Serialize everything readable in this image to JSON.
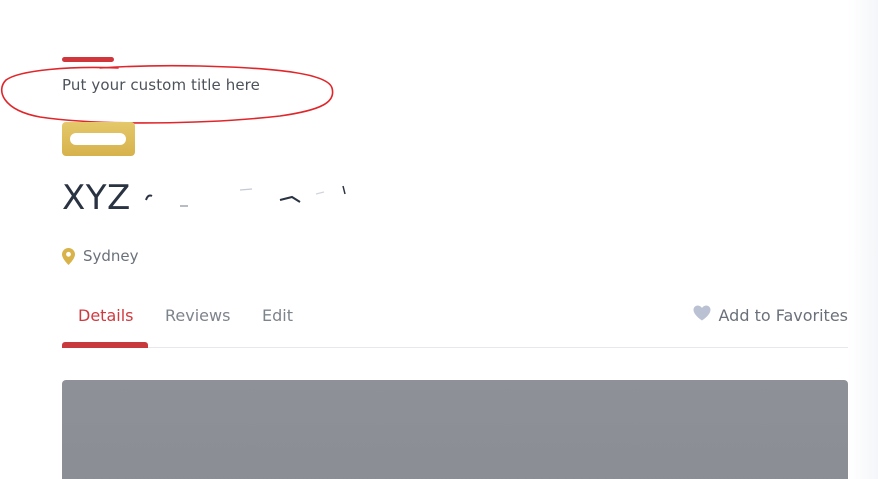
{
  "header": {
    "custom_title": "Put your custom title here"
  },
  "listing": {
    "title_prefix": "XYZ",
    "location": "Sydney"
  },
  "tabs": [
    {
      "label": "Details",
      "active": true
    },
    {
      "label": "Reviews",
      "active": false
    },
    {
      "label": "Edit",
      "active": false
    }
  ],
  "favorites": {
    "label": "Add to Favorites"
  },
  "colors": {
    "accent_red": "#cf3a3f",
    "badge_gold": "#dcb955",
    "pin_gold": "#d8b34a",
    "heart_gray": "#b9c1d2",
    "gallery_gray": "#8e9097"
  },
  "icons": {
    "location": "map-pin-icon",
    "favorite": "heart-icon"
  }
}
